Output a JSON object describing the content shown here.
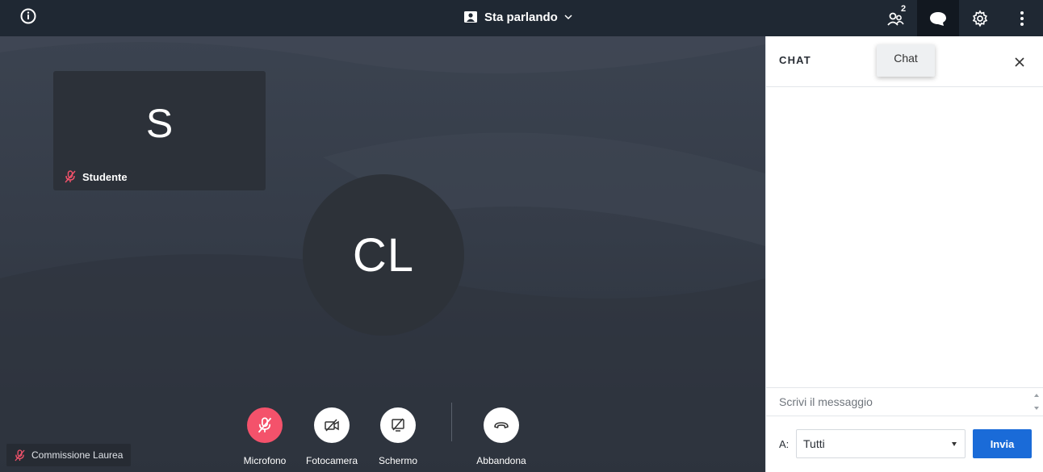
{
  "topbar": {
    "info_icon": "info-circle-icon",
    "layout_label": "Sta parlando",
    "layout_icon": "speaker-view-icon",
    "participants_count": "2",
    "icons": [
      "participants-icon",
      "chat-bubble-icon",
      "gear-icon",
      "more-vertical-icon"
    ]
  },
  "stage": {
    "remote": {
      "initial": "S",
      "name": "Studente",
      "mic_icon": "mic-off-icon"
    },
    "speaker_initials": "CL",
    "local": {
      "name": "Commissione Laurea",
      "mic_icon": "mic-off-icon"
    },
    "controls": [
      {
        "label": "Microfono",
        "icon": "mic-off-icon",
        "color": "#f4526b"
      },
      {
        "label": "Fotocamera",
        "icon": "camera-off-icon"
      },
      {
        "label": "Schermo",
        "icon": "screen-share-off-icon"
      },
      {
        "label": "Abbandona",
        "icon": "hang-up-icon"
      }
    ]
  },
  "chat": {
    "title": "CHAT",
    "tooltip": "Chat",
    "input_placeholder": "Scrivi il messaggio",
    "to_label": "A:",
    "to_value": "Tutti",
    "send_label": "Invia"
  },
  "colors": {
    "topbar": "#1f2833",
    "accent_orange": "#f28a1f",
    "send_button": "#1a6bd8",
    "mic_red": "#f4526b"
  }
}
